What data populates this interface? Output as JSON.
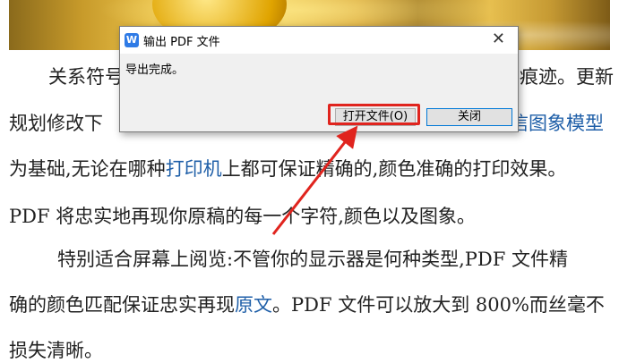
{
  "document": {
    "p1": {
      "l1a": "关系符号",
      "l1b": "痕迹。更新",
      "l2a": "规划修改下",
      "l2b": "信图象模型",
      "l3a": "为基础,无论在哪种",
      "l3link": "打印机",
      "l3b": "上都可保证精确的,颜色准确的打印效果。",
      "l4": "PDF 将忠实地再现你原稿的每一个字符,颜色以及图象。"
    },
    "p2": {
      "l1": "特别适合屏幕上阅览:不管你的显示器是何种类型,PDF 文件精",
      "l2a": "确的颜色匹配保证忠实再现",
      "l2link": "原文",
      "l2b": "。PDF 文件可以放大到 800%而丝毫不",
      "l3": "损失清晰。"
    }
  },
  "dialog": {
    "title": "输出 PDF 文件",
    "close_glyph": "✕",
    "message": "导出完成。",
    "open_button": "打开文件(O)",
    "close_button": "关闭",
    "app_icon_glyph": "W"
  },
  "annotation": {
    "color": "#e0241e"
  }
}
